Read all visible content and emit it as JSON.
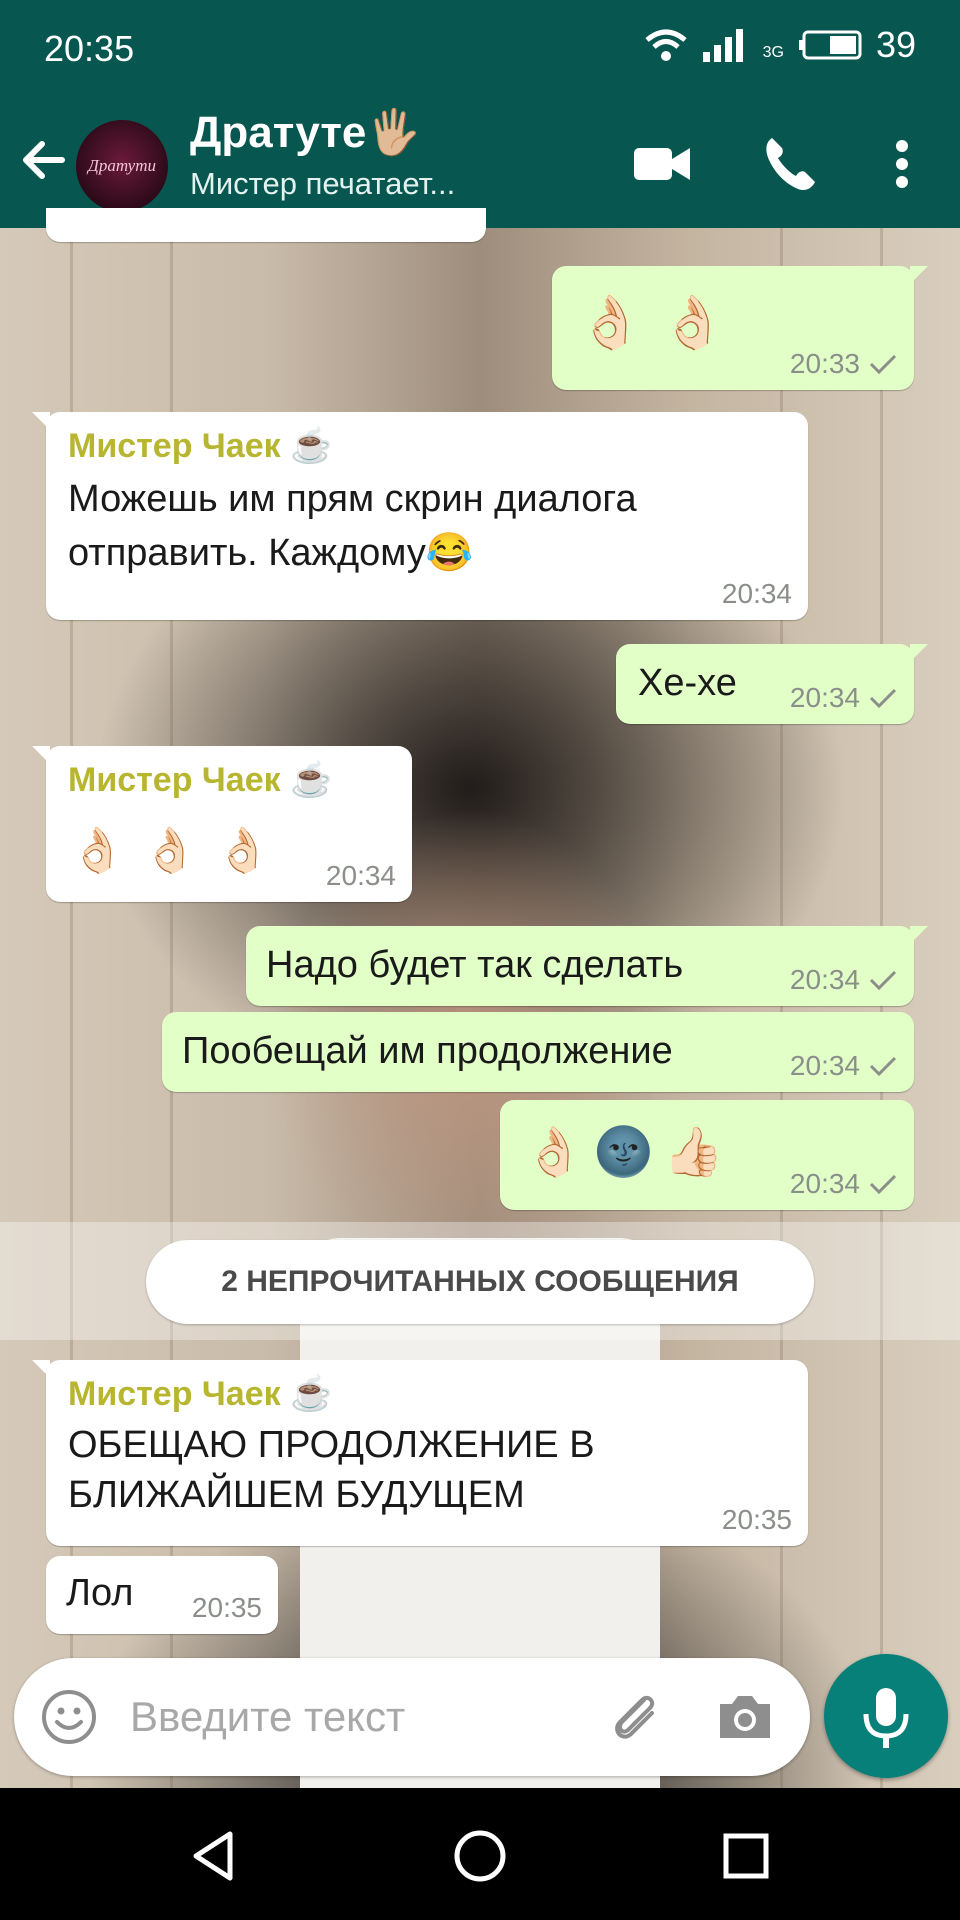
{
  "status_bar": {
    "time": "20:35",
    "network": "3G",
    "battery": "39"
  },
  "header": {
    "avatar_text": "Дратути",
    "title": "Дратуте🖐🏼",
    "subtitle": "Мистер печатает...",
    "icons": [
      "back-arrow-icon",
      "video-call-icon",
      "phone-icon",
      "more-vert-icon"
    ]
  },
  "messages": [
    {
      "dir": "out",
      "emoji": "👌🏻👌🏻",
      "time": "20:33"
    },
    {
      "dir": "in",
      "sender": "Мистер Чаек ☕",
      "text": "Можешь им прям скрин диалога отправить. Каждому😂",
      "time": "20:34"
    },
    {
      "dir": "out",
      "text": "Хе-хе",
      "time": "20:34"
    },
    {
      "dir": "in",
      "sender": "Мистер Чаек ☕",
      "emoji": "👌🏻👌🏻👌🏻",
      "time": "20:34"
    },
    {
      "dir": "out",
      "text": "Надо будет так сделать",
      "time": "20:34"
    },
    {
      "dir": "out",
      "text": "Пообещай им продолжение",
      "time": "20:34"
    },
    {
      "dir": "out",
      "emoji": "👌🏻🌚👍🏻",
      "time": "20:34"
    },
    {
      "dir": "in",
      "sender": "Мистер Чаек ☕",
      "text": "ОБЕЩАЮ ПРОДОЛЖЕНИЕ В БЛИЖАЙШЕМ БУДУЩЕМ",
      "time": "20:35"
    },
    {
      "dir": "in",
      "text": "Лол",
      "time": "20:35"
    }
  ],
  "unread_label": "2 НЕПРОЧИТАННЫХ СООБЩЕНИЯ",
  "input": {
    "placeholder": "Введите текст"
  },
  "colors": {
    "header": "#07564f",
    "out_bubble": "#e1ffc7",
    "in_bubble": "#ffffff",
    "sender": "#b8b631",
    "mic": "#07807a"
  }
}
